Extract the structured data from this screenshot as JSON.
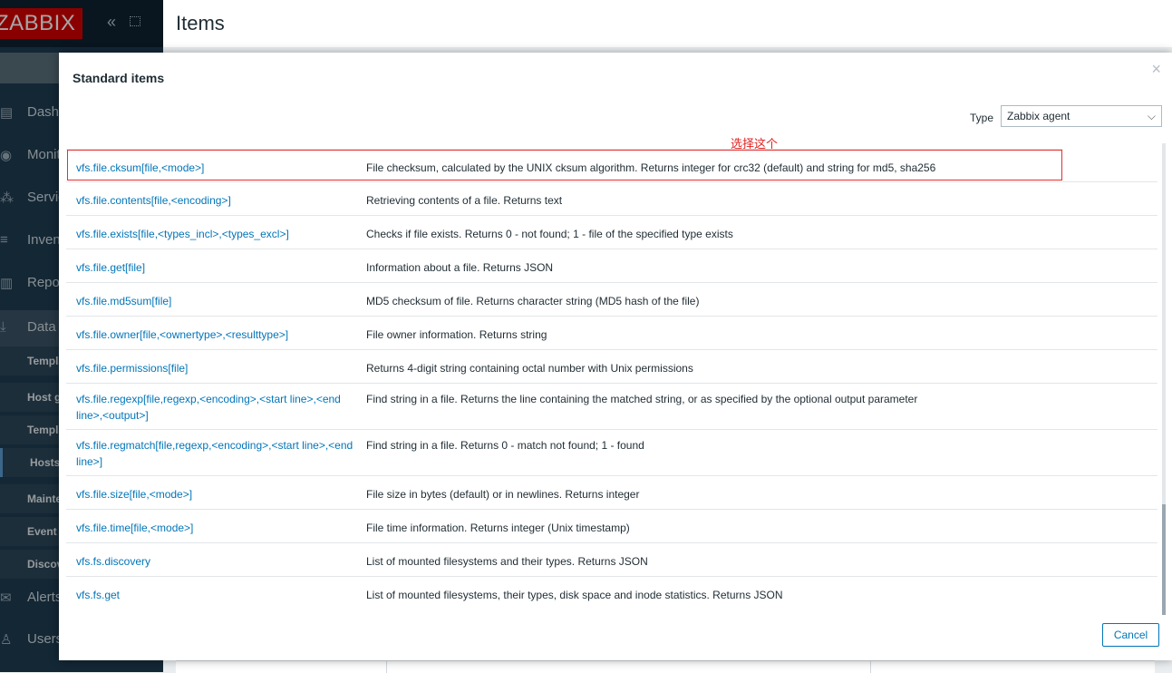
{
  "app": {
    "logo": "ZABBIX",
    "page_title": "Items"
  },
  "sidebar": {
    "items": [
      {
        "label": "Dashboards",
        "icon": "dashboard-icon"
      },
      {
        "label": "Monitoring",
        "icon": "eye-icon"
      },
      {
        "label": "Services",
        "icon": "services-icon"
      },
      {
        "label": "Inventory",
        "icon": "list-icon"
      },
      {
        "label": "Reports",
        "icon": "report-icon"
      },
      {
        "label": "Data collection",
        "icon": "download-icon"
      }
    ],
    "sub_items": [
      {
        "label": "Template groups"
      },
      {
        "label": "Host groups"
      },
      {
        "label": "Templates"
      },
      {
        "label": "Hosts"
      },
      {
        "label": "Maintenance"
      },
      {
        "label": "Event correlation"
      },
      {
        "label": "Discovery"
      }
    ],
    "bottom_items": [
      {
        "label": "Alerts",
        "icon": "envelope-icon"
      },
      {
        "label": "Users",
        "icon": "user-icon"
      }
    ]
  },
  "dialog": {
    "title": "Standard items",
    "close_label": "×",
    "type_label": "Type",
    "type_value": "Zabbix agent",
    "annotation": "选择这个",
    "cancel_label": "Cancel",
    "rows": [
      {
        "key": "vfs.file.cksum[file,<mode>]",
        "description": "File checksum, calculated by the UNIX cksum algorithm. Returns integer for crc32 (default) and string for md5, sha256"
      },
      {
        "key": "vfs.file.contents[file,<encoding>]",
        "description": "Retrieving contents of a file. Returns text"
      },
      {
        "key": "vfs.file.exists[file,<types_incl>,<types_excl>]",
        "description": "Checks if file exists. Returns 0 - not found; 1 - file of the specified type exists"
      },
      {
        "key": "vfs.file.get[file]",
        "description": "Information about a file. Returns JSON"
      },
      {
        "key": "vfs.file.md5sum[file]",
        "description": "MD5 checksum of file. Returns character string (MD5 hash of the file)"
      },
      {
        "key": "vfs.file.owner[file,<ownertype>,<resulttype>]",
        "description": "File owner information. Returns string"
      },
      {
        "key": "vfs.file.permissions[file]",
        "description": "Returns 4-digit string containing octal number with Unix permissions"
      },
      {
        "key": "vfs.file.regexp[file,regexp,<encoding>,<start line>,<end line>,<output>]",
        "description": "Find string in a file. Returns the line containing the matched string, or as specified by the optional output parameter"
      },
      {
        "key": "vfs.file.regmatch[file,regexp,<encoding>,<start line>,<end line>]",
        "description": "Find string in a file. Returns 0 - match not found; 1 - found"
      },
      {
        "key": "vfs.file.size[file,<mode>]",
        "description": "File size in bytes (default) or in newlines. Returns integer"
      },
      {
        "key": "vfs.file.time[file,<mode>]",
        "description": "File time information. Returns integer (Unix timestamp)"
      },
      {
        "key": "vfs.fs.discovery",
        "description": "List of mounted filesystems and their types. Returns JSON"
      },
      {
        "key": "vfs.fs.get",
        "description": "List of mounted filesystems, their types, disk space and inode statistics. Returns JSON"
      }
    ]
  }
}
